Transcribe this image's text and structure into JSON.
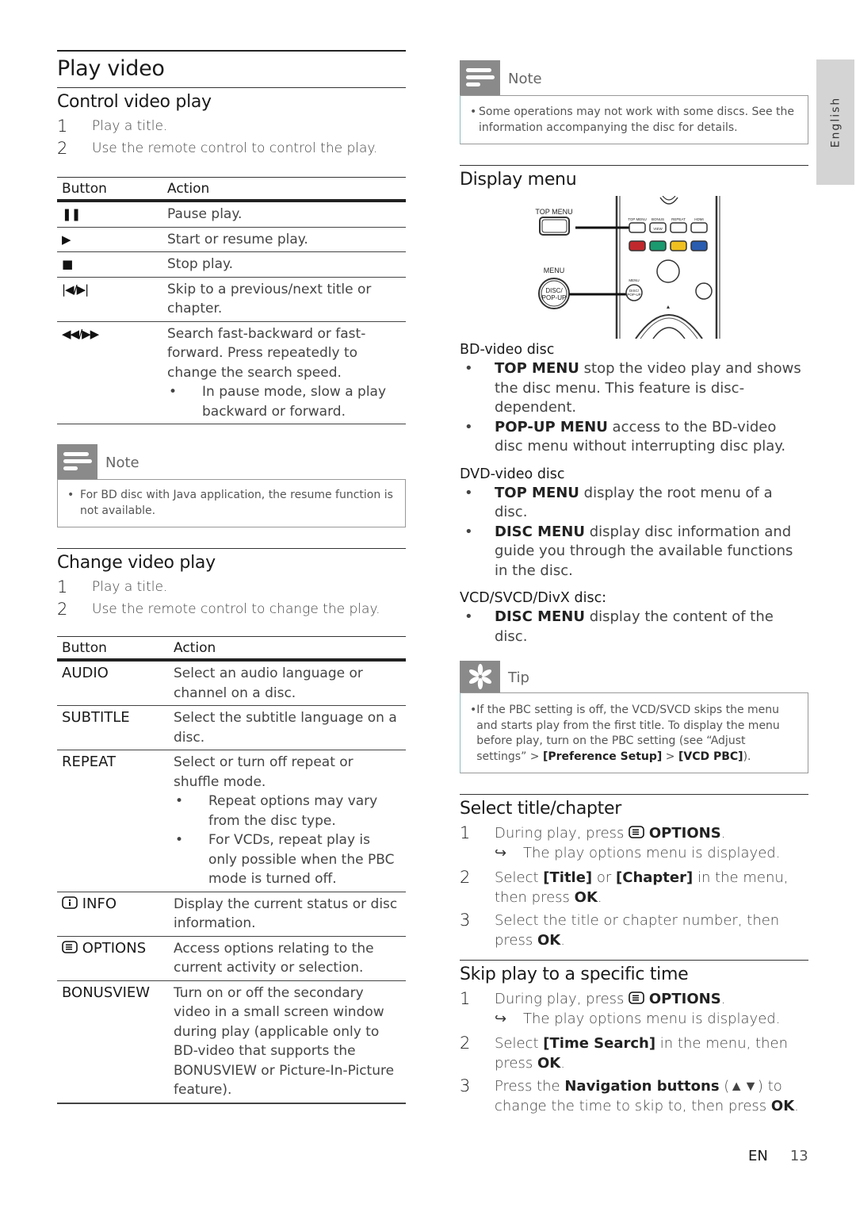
{
  "page": {
    "title": "Play video",
    "side_tab": "English",
    "footer": {
      "lang": "EN",
      "page_number": "13"
    }
  },
  "control_video_play": {
    "heading": "Control video play",
    "steps": [
      {
        "num": "1",
        "text": "Play a title."
      },
      {
        "num": "2",
        "text": "Use the remote control to control the play."
      }
    ],
    "table": {
      "headers": [
        "Button",
        "Action"
      ],
      "rows": [
        {
          "button": "❚❚",
          "icon": "pause-icon",
          "action": "Pause play."
        },
        {
          "button": "▶",
          "icon": "play-icon",
          "action": "Start or resume play."
        },
        {
          "button": "■",
          "icon": "stop-icon",
          "action": "Stop play."
        },
        {
          "button": "|◀/▶|",
          "icon": "skip-previous-next-icon",
          "action": "Skip to a previous/next title or chapter."
        },
        {
          "button": "◀◀/▶▶",
          "icon": "rewind-fast-forward-icon",
          "action": "Search fast-backward or fast-forward. Press repeatedly to change the search speed.",
          "bullets": [
            "In pause mode, slow a play backward or forward."
          ]
        }
      ]
    }
  },
  "note_left": {
    "title": "Note",
    "items": [
      "For BD disc with Java application, the resume function is not available."
    ]
  },
  "change_video_play": {
    "heading": "Change video play",
    "steps": [
      {
        "num": "1",
        "text": "Play a title."
      },
      {
        "num": "2",
        "text": "Use the remote control to change the play."
      }
    ],
    "table": {
      "headers": [
        "Button",
        "Action"
      ],
      "rows": [
        {
          "button": "AUDIO",
          "action": "Select an audio language or channel on a disc."
        },
        {
          "button": "SUBTITLE",
          "action": "Select the subtitle language on a disc."
        },
        {
          "button": "REPEAT",
          "action": "Select or turn off repeat or shuffle mode.",
          "bullets": [
            "Repeat options may vary from the disc type.",
            "For VCDs, repeat play is only possible when the PBC mode is turned off."
          ]
        },
        {
          "button": "INFO",
          "icon": "info-icon",
          "action": "Display the current status or disc information."
        },
        {
          "button": "OPTIONS",
          "icon": "options-icon",
          "action": "Access options relating to the current activity or selection."
        },
        {
          "button": "BONUSVIEW",
          "action": "Turn on or off the secondary video in a small screen window during play (applicable only to BD-video that supports the BONUSVIEW or Picture-In-Picture feature)."
        }
      ]
    }
  },
  "note_right": {
    "title": "Note",
    "items": [
      "Some operations may not work with some discs. See the information accompanying the disc for details."
    ]
  },
  "display_menu": {
    "heading": "Display menu",
    "remote_labels": {
      "top_menu": "TOP MENU",
      "menu": "MENU",
      "disc_popup": "DISC/\nPOP-UP",
      "small_top_menu": "TOP MENU",
      "bonus": "BONUS",
      "view": "VIEW",
      "repeat": "REPEAT",
      "hdmi": "HDMI"
    },
    "color_buttons": [
      "#c0282d",
      "#1a9a6e",
      "#f0c020",
      "#2a5cb0"
    ],
    "groups": [
      {
        "title": "BD-video disc",
        "items": [
          {
            "key": "TOP MENU",
            "text": " stop the video play and shows the disc menu. This feature is disc-dependent."
          },
          {
            "key": "POP-UP MENU",
            "text": " access to the BD-video disc menu without interrupting disc play."
          }
        ]
      },
      {
        "title": "DVD-video disc",
        "items": [
          {
            "key": "TOP MENU",
            "text": " display the root menu of a disc."
          },
          {
            "key": "DISC MENU",
            "text": " display disc information and guide you through the available functions in the disc."
          }
        ]
      },
      {
        "title": "VCD/SVCD/DivX disc:",
        "items": [
          {
            "key": "DISC MENU",
            "text": " display the content of the disc."
          }
        ]
      }
    ]
  },
  "tip": {
    "title": "Tip",
    "text_a": "If the PBC setting is off, the VCD/SVCD skips the menu and starts play from the first title. To display the menu before play, turn on the PBC setting (see “Adjust settings” > ",
    "key_a": "[Preference Setup]",
    "text_b": " > ",
    "key_b": "[VCD PBC]",
    "text_c": ")."
  },
  "select_title": {
    "heading": "Select title/chapter",
    "s1_num": "1",
    "s1_text": "During play, press ",
    "s1_key": "OPTIONS",
    "s1_end": ".",
    "s1_result": "The play options menu is displayed.",
    "s2_num": "2",
    "s2_text": "Select ",
    "s2_key1": "[Title]",
    "s2_mid": " or ",
    "s2_key2": "[Chapter]",
    "s2_text2": " in the menu, then press ",
    "s2_key3": "OK",
    "s2_end": ".",
    "s3_num": "3",
    "s3_text": "Select the title or chapter number, then press ",
    "s3_key": "OK",
    "s3_end": "."
  },
  "skip_time": {
    "heading": "Skip play to a specific time",
    "s1_num": "1",
    "s1_text": "During play, press ",
    "s1_key": "OPTIONS",
    "s1_end": ".",
    "s1_result": "The play options menu is displayed.",
    "s2_num": "2",
    "s2_text": "Select ",
    "s2_key": "[Time Search]",
    "s2_text2": " in the menu, then press ",
    "s2_key2": "OK",
    "s2_end": ".",
    "s3_num": "3",
    "s3_text": "Press the ",
    "s3_key": "Navigation buttons",
    "s3_paren": " (▲▼)",
    "s3_text2": " to change the time to skip to, then press ",
    "s3_key2": "OK",
    "s3_end": "."
  }
}
